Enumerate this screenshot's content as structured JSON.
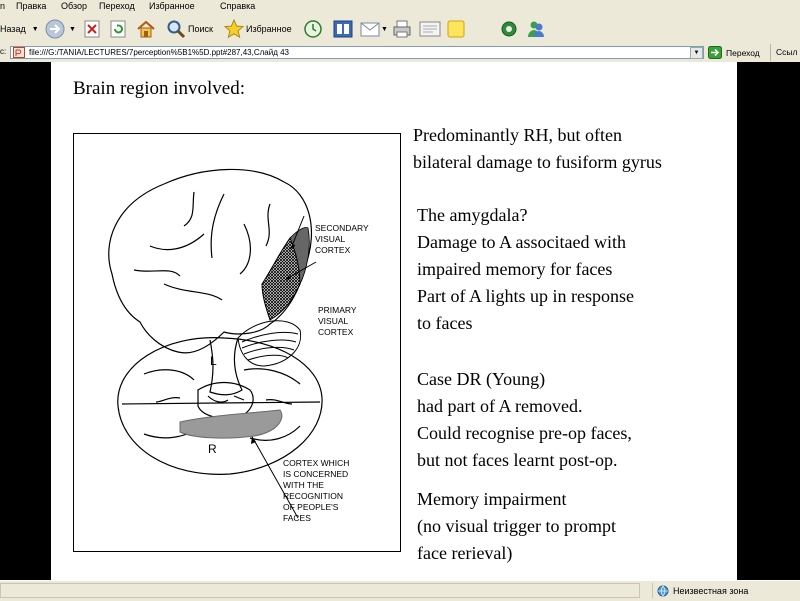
{
  "menubar": {
    "items": [
      "n",
      "Правка",
      "Обзор",
      "Переход",
      "Избранное",
      "Справка"
    ]
  },
  "toolbar": {
    "back_label": "Назад",
    "search_label": "Поиск",
    "favorites_label": "Избранное"
  },
  "addressbar": {
    "label": "с:",
    "url": "file:///G:/TANIA/LECTURES/7perception%5B1%5D.ppt#287,43,Слайд 43",
    "go_label": "Переход",
    "links_label": "Ссыл"
  },
  "slide": {
    "title": "Brain region involved:",
    "block1": [
      "Predominantly RH, but often",
      "bilateral damage to fusiform gyrus"
    ],
    "block2": [
      "The amygdala?",
      "Damage  to A associtaed with",
      "impaired memory for faces",
      "Part of A lights up in response",
      "to faces"
    ],
    "block3": [
      "Case DR (Young)",
      "had part of A removed.",
      "Could recognise pre-op faces,",
      "but not faces learnt post-op."
    ],
    "block4": [
      "Memory impairment",
      "(no visual trigger to prompt",
      "face rerieval)"
    ],
    "figure": {
      "secondary_label": [
        "SECONDARY",
        "VISUAL",
        "CORTEX"
      ],
      "primary_label": [
        "PRIMARY",
        "VISUAL",
        "CORTEX"
      ],
      "hemisphere_left": "L",
      "hemisphere_right": "R",
      "cortex_label": [
        "CORTEX WHICH",
        "IS CONCERNED",
        "WITH THE",
        "RECOGNITION",
        "OF PEOPLE'S",
        "FACES"
      ]
    }
  },
  "statusbar": {
    "zone": "Неизвестная зона"
  }
}
